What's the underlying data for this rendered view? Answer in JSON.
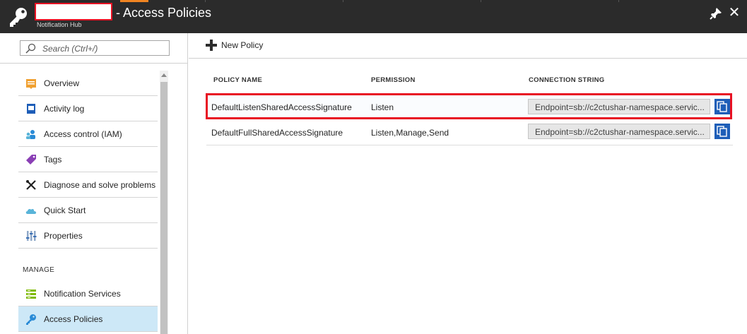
{
  "header": {
    "title": "- Access Policies",
    "subtitle": "Notification Hub",
    "pin_icon": "pin-icon",
    "close_icon": "close-icon",
    "logo_icon": "key-icon"
  },
  "nav": {
    "search_placeholder": "Search (Ctrl+/)",
    "items": [
      {
        "label": "Overview",
        "icon": "overview-icon"
      },
      {
        "label": "Activity log",
        "icon": "activity-log-icon"
      },
      {
        "label": "Access control (IAM)",
        "icon": "iam-icon"
      },
      {
        "label": "Tags",
        "icon": "tag-icon"
      },
      {
        "label": "Diagnose and solve problems",
        "icon": "wrench-icon"
      },
      {
        "label": "Quick Start",
        "icon": "cloud-icon"
      },
      {
        "label": "Properties",
        "icon": "properties-icon"
      }
    ],
    "section_manage": "MANAGE",
    "manage_items": [
      {
        "label": "Notification Services",
        "icon": "notification-services-icon"
      },
      {
        "label": "Access Policies",
        "icon": "key-icon",
        "active": true
      }
    ]
  },
  "main": {
    "new_policy_label": "New Policy",
    "columns": {
      "policy_name": "POLICY NAME",
      "permission": "PERMISSION",
      "connection_string": "CONNECTION STRING"
    },
    "rows": [
      {
        "policy_name": "DefaultListenSharedAccessSignature",
        "permission": "Listen",
        "connection_string": "Endpoint=sb://c2ctushar-namespace.servic...",
        "selected": true
      },
      {
        "policy_name": "DefaultFullSharedAccessSignature",
        "permission": "Listen,Manage,Send",
        "connection_string": "Endpoint=sb://c2ctushar-namespace.servic...",
        "selected": false
      }
    ]
  },
  "colors": {
    "header_bg": "#2b2b2b",
    "accent_orange": "#f08422",
    "highlight_red": "#e81123",
    "active_nav_bg": "#cde8f7",
    "copy_button": "#1e5eb8"
  }
}
